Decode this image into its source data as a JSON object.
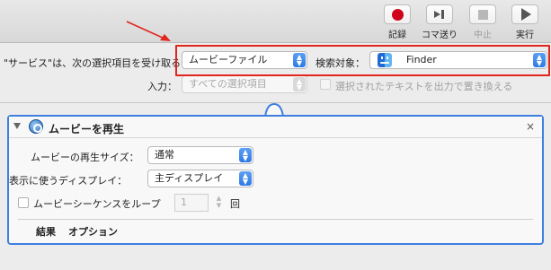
{
  "toolbar": {
    "buttons": [
      {
        "label": "記録",
        "icon": "record-icon",
        "enabled": true
      },
      {
        "label": "コマ送り",
        "icon": "step-icon",
        "enabled": true
      },
      {
        "label": "中止",
        "icon": "stop-icon",
        "enabled": false
      },
      {
        "label": "実行",
        "icon": "run-icon",
        "enabled": true
      }
    ]
  },
  "service": {
    "receives_label": "\"サービス\"は、次の選択項目を受け取る：",
    "input_type": "ムービーファイル",
    "search_target_label": "検索対象：",
    "search_target": "Finder",
    "input_label": "入力：",
    "input_value": "すべての選択項目",
    "replace_label": "選択されたテキストを出力で置き換える"
  },
  "action": {
    "title": "ムービーを再生",
    "close_glyph": "×",
    "size_label": "ムービーの再生サイズ：",
    "size_value": "通常",
    "display_label": "表示に使うディスプレイ：",
    "display_value": "主ディスプレイ",
    "loop_label": "ムービーシーケンスをループ",
    "loop_count": "1",
    "loop_unit": "回",
    "tabs": [
      "結果",
      "オプション"
    ]
  },
  "colors": {
    "highlight": "#e0261d",
    "panel_border": "#3d7fe0",
    "record": "#d0021b"
  }
}
